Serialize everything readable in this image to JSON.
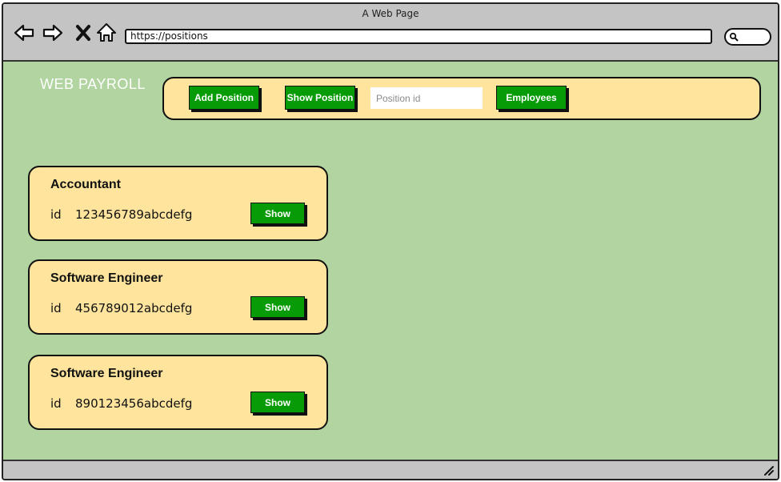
{
  "window": {
    "title": "A Web Page"
  },
  "browser": {
    "url": "https://positions"
  },
  "app": {
    "brand": "WEB PAYROLL"
  },
  "nav": {
    "add_position": "Add Position",
    "show_position": "Show Position",
    "position_placeholder": "Position id",
    "employees": "Employees"
  },
  "positions": [
    {
      "title": "Accountant",
      "id_label": "id",
      "id": "123456789abcdefg",
      "action": "Show"
    },
    {
      "title": "Software Engineer",
      "id_label": "id",
      "id": "456789012abcdefg",
      "action": "Show"
    },
    {
      "title": "Software Engineer",
      "id_label": "id",
      "id": "890123456abcdefg",
      "action": "Show"
    }
  ],
  "colors": {
    "page_bg": "#b1d4a0",
    "panel_bg": "#fee49c",
    "button_green": "#079c07",
    "chrome_gray": "#c4c4c4"
  },
  "icons": [
    "back-arrow-icon",
    "forward-arrow-icon",
    "close-x-icon",
    "home-icon",
    "search-icon",
    "resize-grip-icon"
  ]
}
